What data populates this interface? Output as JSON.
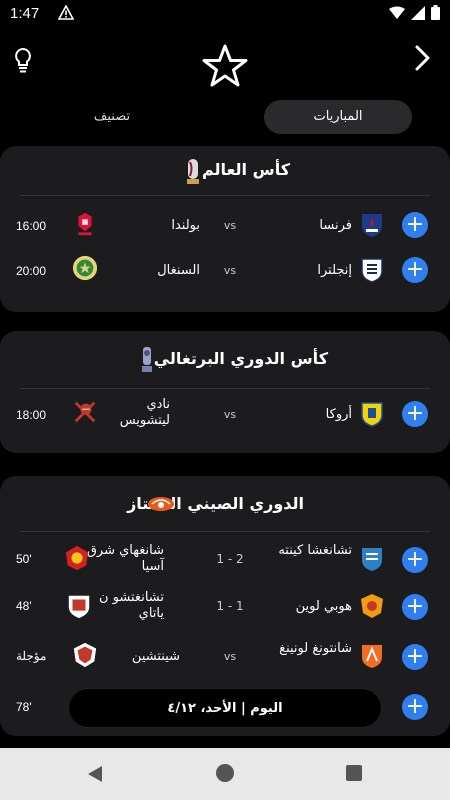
{
  "status_bar": {
    "time": "1:47"
  },
  "tabs": {
    "matches": "المباريات",
    "ranking": "تصنيف"
  },
  "leagues": [
    {
      "title": "كأس العالم",
      "matches": [
        {
          "home": "فرنسا",
          "away": "بولندا",
          "center": "vs",
          "time": "16:00"
        },
        {
          "home": "إنجلترا",
          "away": "السنغال",
          "center": "vs",
          "time": "20:00"
        }
      ]
    },
    {
      "title": "كأس الدوري البرتغالي",
      "matches": [
        {
          "home": "أروكا",
          "away": "نادي ليتشويس",
          "center": "vs",
          "time": "18:00"
        }
      ]
    },
    {
      "title": "الدوري الصيني الممتاز",
      "matches": [
        {
          "home": "تشانغشا كينته",
          "away": "شانغهاي شرق آسيا",
          "center": "1 - 2",
          "time": "50'"
        },
        {
          "home": "هوبي لوين",
          "away": "تشانغتشو ن ياتاي",
          "center": "1 - 1",
          "time": "48'"
        },
        {
          "home": "شانتونغ لونينغ",
          "away": "شينتشين",
          "center": "vs",
          "time": "مؤجلة"
        },
        {
          "home": "",
          "away": "",
          "center": "",
          "time": "78'"
        }
      ]
    }
  ],
  "date_pill": "اليوم | الأحد، ٤/١٢",
  "colors": {
    "accent": "#2f7ff0",
    "card": "#1c1c1e",
    "background": "#000000"
  }
}
